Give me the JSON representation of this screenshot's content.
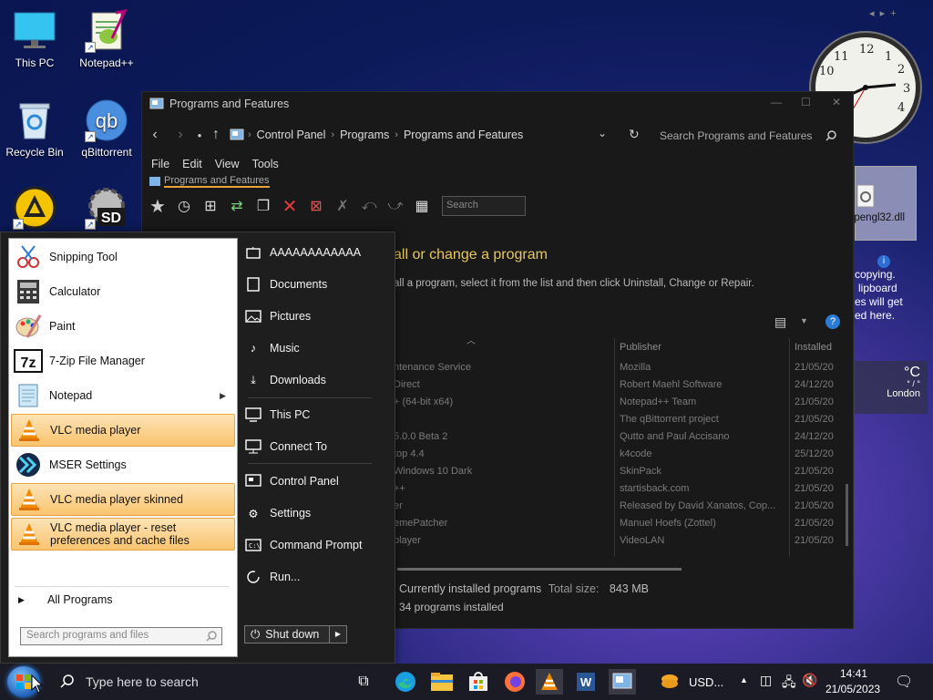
{
  "desktop": {
    "icons": [
      {
        "label": "This PC"
      },
      {
        "label": "Notepad++"
      },
      {
        "label": "Recycle Bin"
      },
      {
        "label": "qBittorrent"
      },
      {
        "label": ""
      },
      {
        "label": ""
      }
    ],
    "dll_tile_label": "opengl32.dll",
    "notification": {
      "line1": "copying.",
      "line2": "lipboard",
      "line3": "es will get",
      "line4": "ed here."
    },
    "weather": {
      "unit": "°C",
      "dots": "° / °",
      "city": "London"
    },
    "clock_numbers": [
      "12",
      "1",
      "2",
      "3",
      "4",
      "11",
      "10"
    ]
  },
  "window": {
    "title": "Programs and Features",
    "breadcrumbs": [
      "Control Panel",
      "Programs",
      "Programs and Features"
    ],
    "search_placeholder": "Search Programs and Features",
    "menu": [
      "File",
      "Edit",
      "View",
      "Tools"
    ],
    "tab_label": "Programs and Features",
    "toolbar_search_placeholder": "Search",
    "heading": "all or change a program",
    "description": "all a program, select it from the list and then click Uninstall, Change or Repair.",
    "columns": {
      "publisher": "Publisher",
      "installed": "Installed"
    },
    "rows": [
      {
        "name": "ntenance Service",
        "publisher": "Mozilla",
        "installed": "21/05/20"
      },
      {
        "name": "Direct",
        "publisher": "Robert Maehl Software",
        "installed": "24/12/20"
      },
      {
        "name": "+ (64-bit x64)",
        "publisher": "Notepad++ Team",
        "installed": "21/05/20"
      },
      {
        "name": "",
        "publisher": "The qBittorrent project",
        "installed": "21/05/20"
      },
      {
        "name": "5.0.0 Beta 2",
        "publisher": "Qutto and Paul Accisano",
        "installed": "24/12/20"
      },
      {
        "name": "top 4.4",
        "publisher": "k4code",
        "installed": "25/12/20"
      },
      {
        "name": "Windows 10 Dark",
        "publisher": "SkinPack",
        "installed": "21/05/20"
      },
      {
        "name": "++",
        "publisher": "startisback.com",
        "installed": "21/05/20"
      },
      {
        "name": "er",
        "publisher": "Released by David Xanatos, Cop...",
        "installed": "21/05/20"
      },
      {
        "name": "emePatcher",
        "publisher": "Manuel Hoefs (Zottel)",
        "installed": "21/05/20"
      },
      {
        "name": "player",
        "publisher": "VideoLAN",
        "installed": "21/05/20"
      }
    ],
    "status_line1": "Currently installed programs",
    "status_total_label": "Total size:",
    "status_total_value": "843 MB",
    "status_line2": "34 programs installed"
  },
  "start_menu": {
    "programs": [
      {
        "label": "Snipping Tool"
      },
      {
        "label": "Calculator"
      },
      {
        "label": "Paint"
      },
      {
        "label": "7-Zip File Manager"
      },
      {
        "label": "Notepad"
      },
      {
        "label": "VLC media player"
      },
      {
        "label": "MSER Settings"
      },
      {
        "label": "VLC media player skinned"
      },
      {
        "label": "VLC media player - reset preferences and cache files"
      }
    ],
    "all_programs": "All Programs",
    "search_placeholder": "Search programs and files",
    "right": [
      "AAAAAAAAAAAA",
      "Documents",
      "Pictures",
      "Music",
      "Downloads",
      "This PC",
      "Connect To",
      "Control Panel",
      "Settings",
      "Command Prompt",
      "Run..."
    ],
    "shutdown": "Shut down"
  },
  "taskbar": {
    "search_placeholder": "Type here to search",
    "currency": "USD...",
    "time": "14:41",
    "date": "21/05/2023"
  }
}
